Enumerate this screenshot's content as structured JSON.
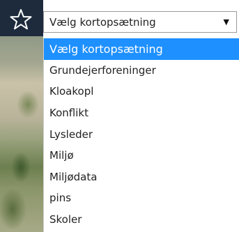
{
  "toolbar": {
    "favorite_icon": "star-outline-icon"
  },
  "layer_select": {
    "current_value": "Vælg kortopsætning",
    "arrow_glyph": "▼"
  },
  "dropdown": {
    "options": [
      {
        "label": "Vælg kortopsætning",
        "selected": true
      },
      {
        "label": "Grundejerforeninger",
        "selected": false
      },
      {
        "label": "Kloakopl",
        "selected": false
      },
      {
        "label": "Konflikt",
        "selected": false
      },
      {
        "label": "Lysleder",
        "selected": false
      },
      {
        "label": "Miljø",
        "selected": false
      },
      {
        "label": "Miljødata",
        "selected": false
      },
      {
        "label": "pins",
        "selected": false
      },
      {
        "label": "Skoler",
        "selected": false
      }
    ],
    "highlight_color": "#1e90ff"
  }
}
